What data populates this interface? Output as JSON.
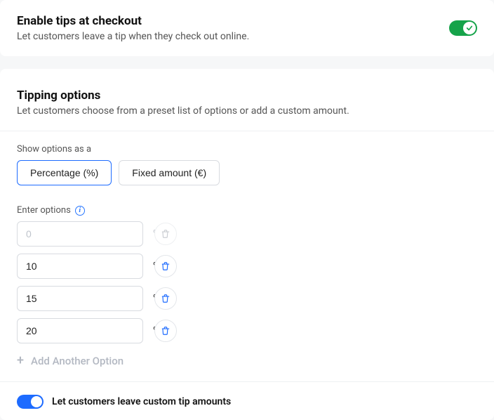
{
  "enable_card": {
    "title": "Enable tips at checkout",
    "subtitle": "Let customers leave a tip when they check out online.",
    "enabled": true
  },
  "tipping_card": {
    "title": "Tipping options",
    "subtitle": "Let customers choose from a preset list of options or add a custom amount.",
    "show_options_label": "Show options as a",
    "tabs": {
      "percentage": "Percentage (%)",
      "fixed_amount": "Fixed amount (€)",
      "active": "percentage"
    },
    "enter_options_label": "Enter options",
    "unit": "%",
    "options": [
      {
        "value": "0",
        "disabled": true
      },
      {
        "value": "10",
        "disabled": false
      },
      {
        "value": "15",
        "disabled": false
      },
      {
        "value": "20",
        "disabled": false
      }
    ],
    "add_another_label": "Add Another Option",
    "custom_tips": {
      "enabled": true,
      "label": "Let customers leave custom tip amounts"
    }
  }
}
